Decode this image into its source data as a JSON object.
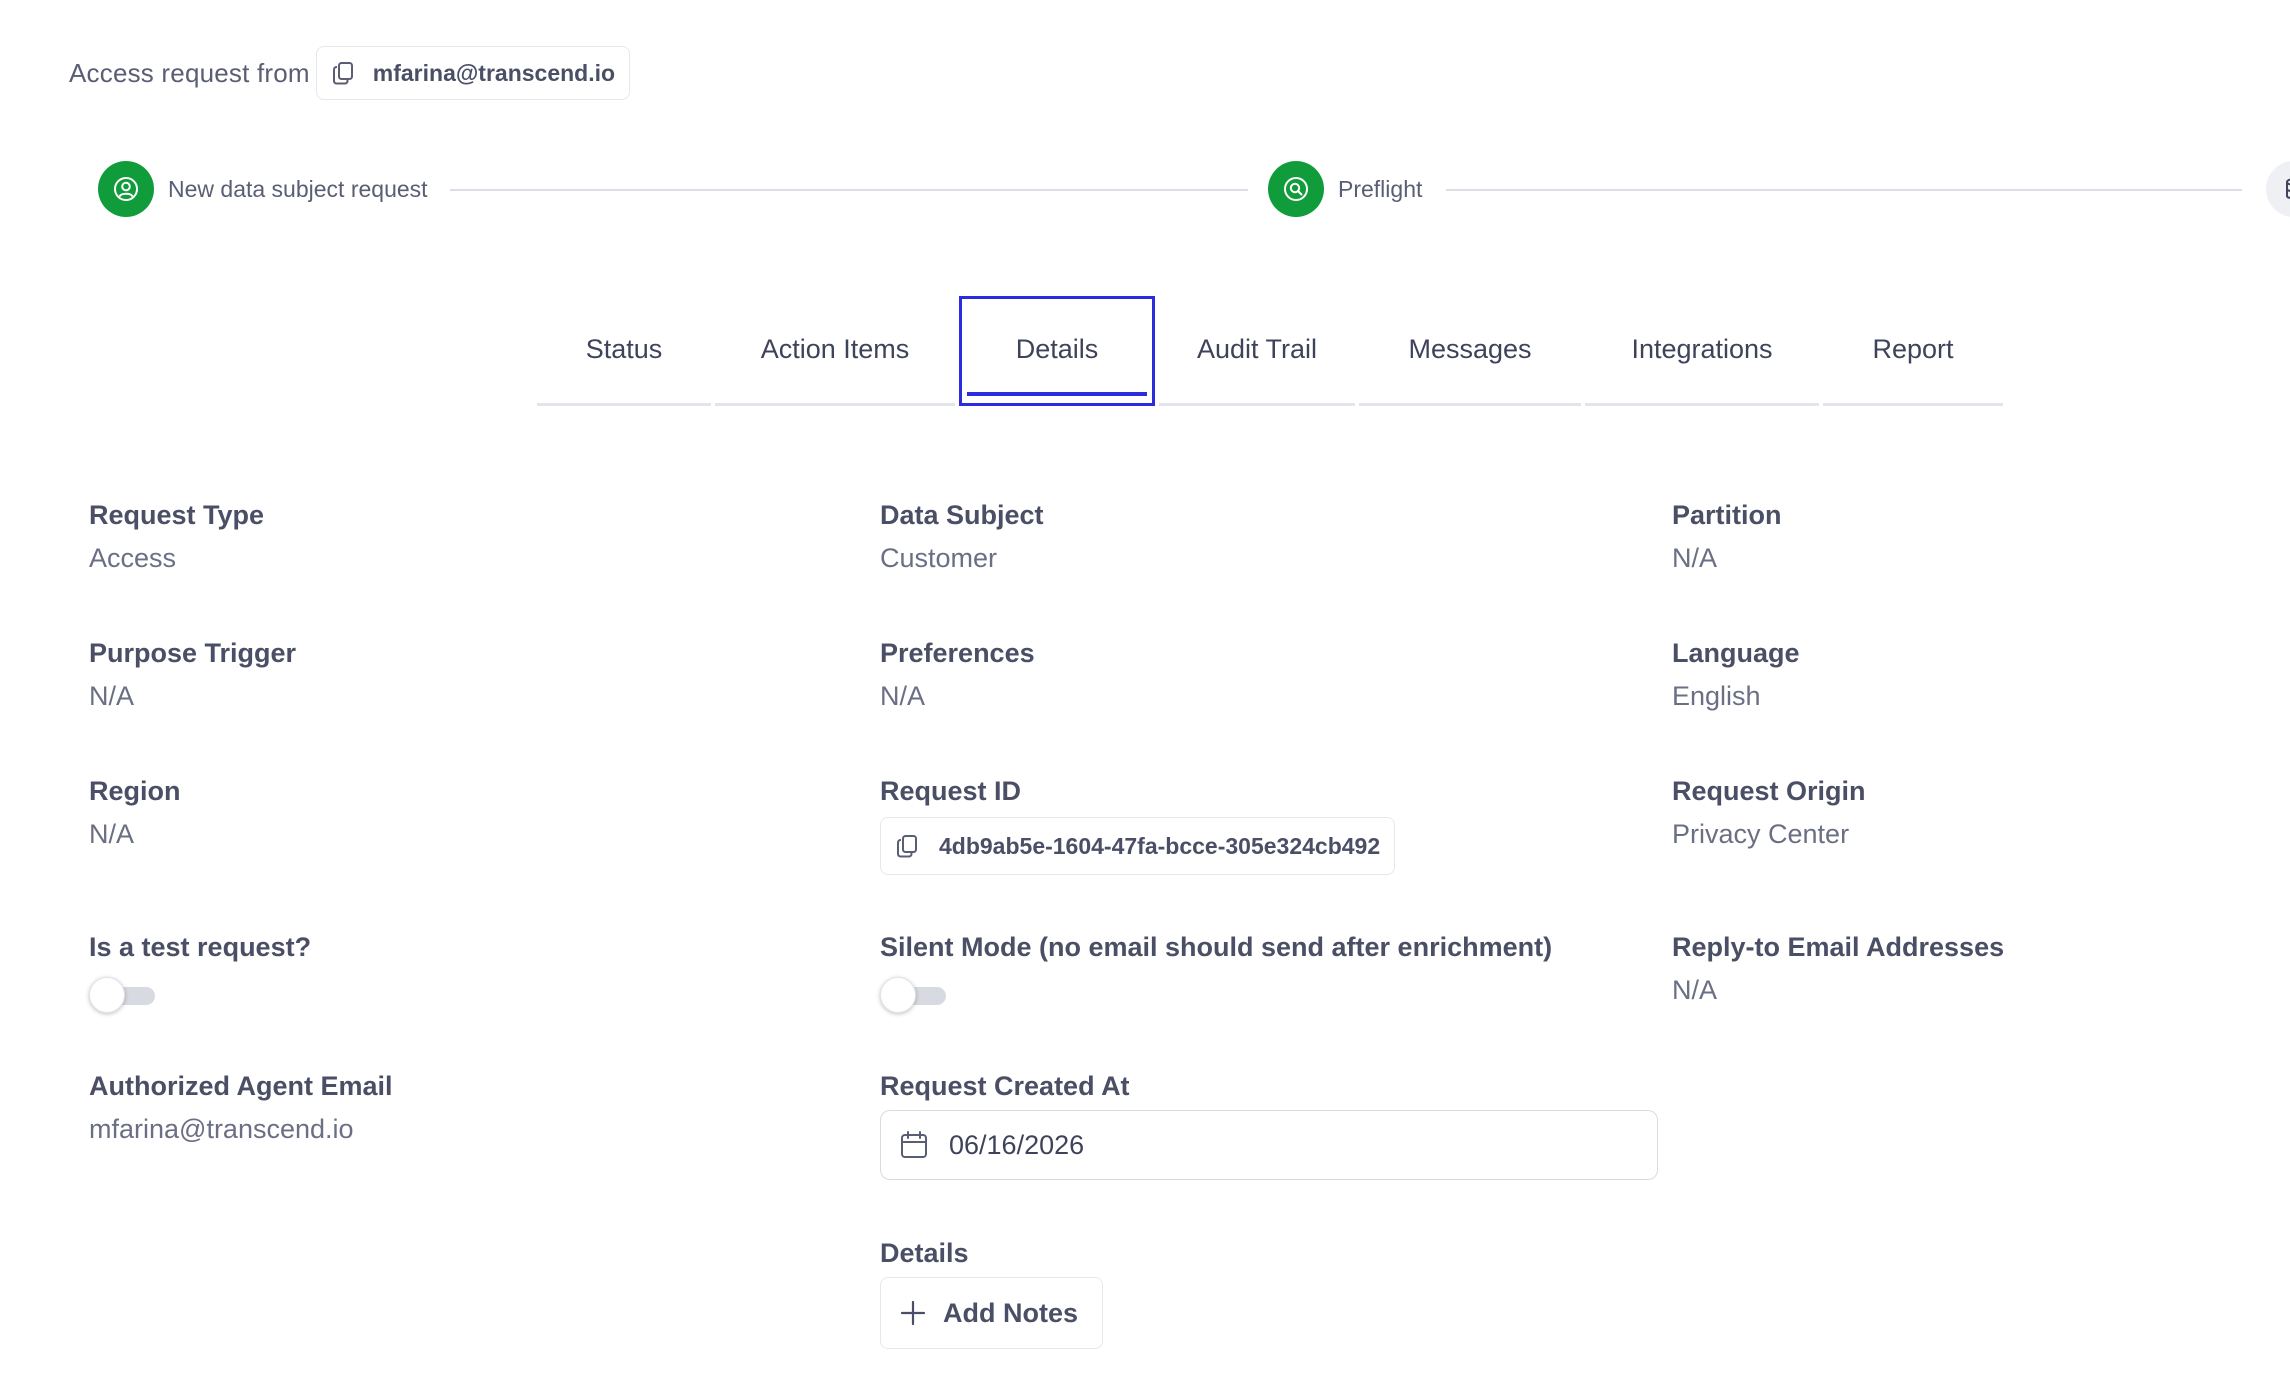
{
  "header": {
    "label": "Access request from",
    "email": "mfarina@transcend.io"
  },
  "stepper": {
    "steps": [
      {
        "label": "New data subject request",
        "icon": "user-circle-icon",
        "status": "complete"
      },
      {
        "label": "Preflight",
        "icon": "search-icon",
        "status": "complete"
      },
      {
        "label": "",
        "icon": "database-icon",
        "status": "pending"
      }
    ],
    "colors": {
      "complete": "#109c3a",
      "pending": "#eef0f4",
      "line": "#dcdee6"
    }
  },
  "tabs": {
    "items": [
      {
        "label": "Status"
      },
      {
        "label": "Action Items"
      },
      {
        "label": "Details"
      },
      {
        "label": "Audit Trail"
      },
      {
        "label": "Messages"
      },
      {
        "label": "Integrations"
      },
      {
        "label": "Report"
      }
    ],
    "active": "Details",
    "accent": "#2b2be0"
  },
  "fields": {
    "request_type": {
      "label": "Request Type",
      "value": "Access"
    },
    "data_subject": {
      "label": "Data Subject",
      "value": "Customer"
    },
    "partition": {
      "label": "Partition",
      "value": "N/A"
    },
    "purpose_trigger": {
      "label": "Purpose Trigger",
      "value": "N/A"
    },
    "preferences": {
      "label": "Preferences",
      "value": "N/A"
    },
    "language": {
      "label": "Language",
      "value": "English"
    },
    "region": {
      "label": "Region",
      "value": "N/A"
    },
    "request_id": {
      "label": "Request ID",
      "value": "4db9ab5e-1604-47fa-bcce-305e324cb492"
    },
    "request_origin": {
      "label": "Request Origin",
      "value": "Privacy Center"
    },
    "is_test": {
      "label": "Is a test request?",
      "checked": false
    },
    "silent_mode": {
      "label": "Silent Mode (no email should send after enrichment)",
      "checked": false
    },
    "reply_to": {
      "label": "Reply-to Email Addresses",
      "value": "N/A"
    },
    "authorized_agent_email": {
      "label": "Authorized Agent Email",
      "value": "mfarina@transcend.io"
    },
    "request_created_at": {
      "label": "Request Created At",
      "value": "06/16/2026"
    },
    "details": {
      "label": "Details",
      "button": "Add Notes"
    }
  }
}
